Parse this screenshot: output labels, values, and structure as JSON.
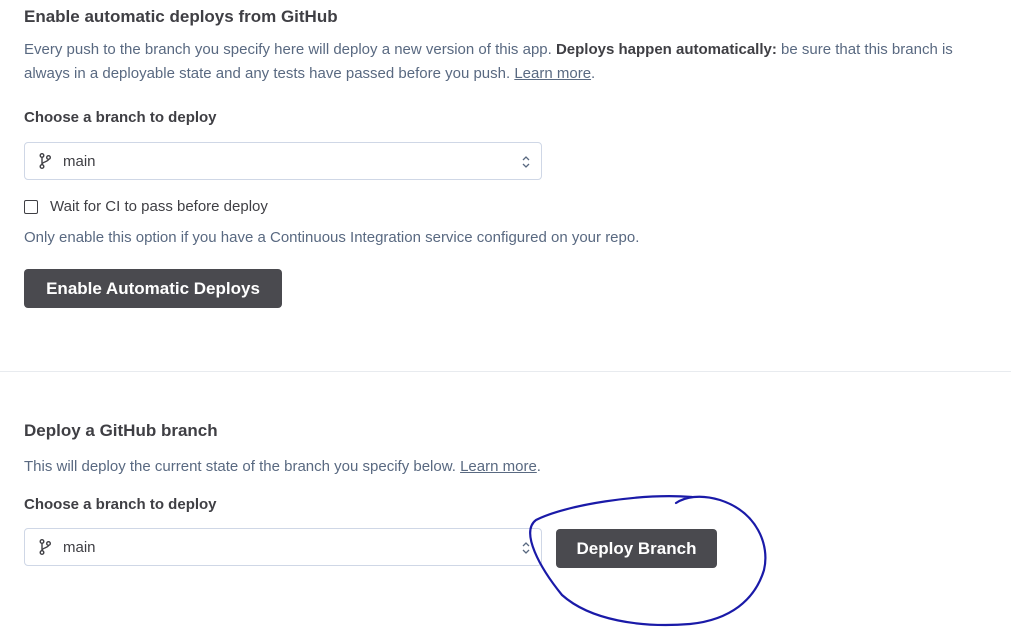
{
  "auto_deploy": {
    "heading": "Enable automatic deploys from GitHub",
    "description_part1": "Every push to the branch you specify here will deploy a new version of this app.",
    "description_bold": "Deploys happen automatically:",
    "description_part2": "be sure that this branch is always in a deployable state and any tests have passed before you push.",
    "learn_more": "Learn more",
    "period": ".",
    "branch_label": "Choose a branch to deploy",
    "branch_value": "main",
    "ci_checkbox_label": "Wait for CI to pass before deploy",
    "ci_checked": false,
    "ci_help": "Only enable this option if you have a Continuous Integration service configured on your repo.",
    "enable_button": "Enable Automatic Deploys"
  },
  "manual_deploy": {
    "heading": "Deploy a GitHub branch",
    "description": "This will deploy the current state of the branch you specify below.",
    "learn_more": "Learn more",
    "period": ".",
    "branch_label": "Choose a branch to deploy",
    "branch_value": "main",
    "deploy_button": "Deploy Branch"
  },
  "icons": {
    "branch": "git-branch-icon",
    "select_arrows": "chevron-up-down-icon"
  },
  "colors": {
    "button_bg": "#4a4a4f",
    "annotation_ink": "#1a1aa8",
    "muted_text": "#596981"
  }
}
